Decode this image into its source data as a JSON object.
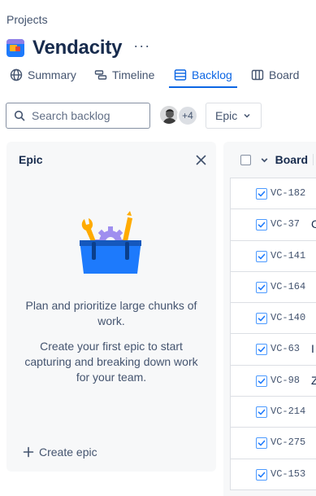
{
  "breadcrumb": "Projects",
  "project": {
    "name": "Vendacity",
    "more_label": "···"
  },
  "tabs": [
    {
      "label": "Summary"
    },
    {
      "label": "Timeline"
    },
    {
      "label": "Backlog",
      "active": true
    },
    {
      "label": "Board"
    }
  ],
  "search": {
    "placeholder": "Search backlog",
    "value": ""
  },
  "avatars": {
    "extra_count": "+4"
  },
  "epic_filter": {
    "label": "Epic"
  },
  "epic_panel": {
    "title": "Epic",
    "empty_heading": "Plan and prioritize large chunks of work.",
    "empty_body": "Create your first epic to start capturing and breaking down work for your team.",
    "create_label": "Create epic"
  },
  "board": {
    "title": "Board",
    "issues": [
      {
        "key": "VC-182",
        "summary": ""
      },
      {
        "key": "VC-37",
        "summary": "C"
      },
      {
        "key": "VC-141",
        "summary": ""
      },
      {
        "key": "VC-164",
        "summary": ""
      },
      {
        "key": "VC-140",
        "summary": ""
      },
      {
        "key": "VC-63",
        "summary": "I"
      },
      {
        "key": "VC-98",
        "summary": "Z"
      },
      {
        "key": "VC-214",
        "summary": ""
      },
      {
        "key": "VC-275",
        "summary": ""
      },
      {
        "key": "VC-153",
        "summary": ""
      }
    ]
  },
  "colors": {
    "accent": "#0c66e4",
    "panel_bg": "#f7f8f9",
    "text": "#172b4d",
    "muted": "#44546f"
  }
}
